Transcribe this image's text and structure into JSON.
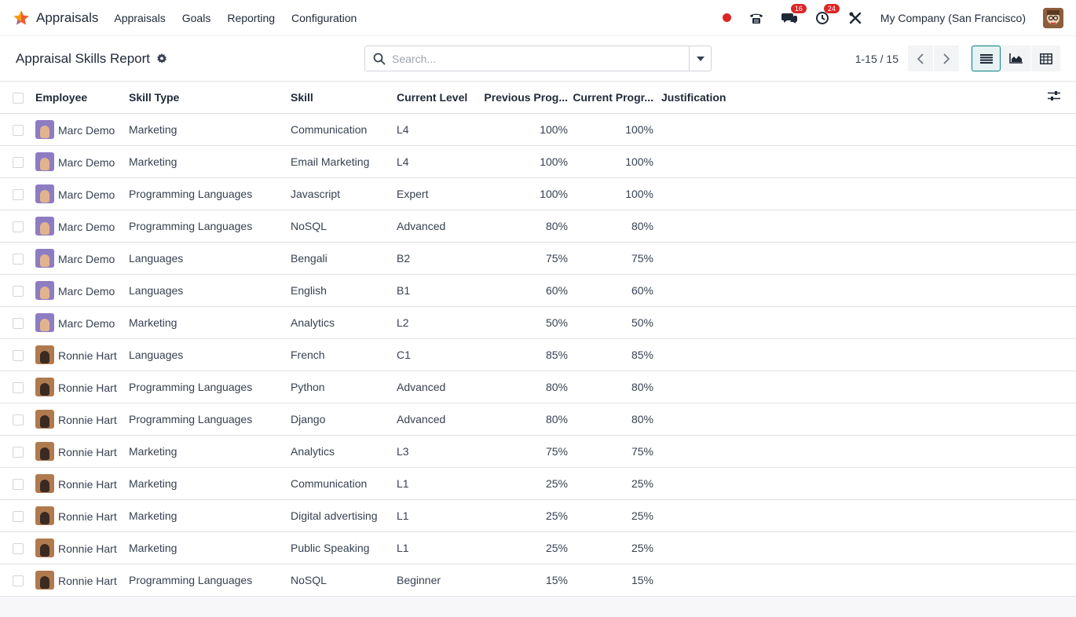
{
  "navbar": {
    "app_name": "Appraisals",
    "menu": [
      "Appraisals",
      "Goals",
      "Reporting",
      "Configuration"
    ],
    "messages_count": "16",
    "activities_count": "24",
    "company": "My Company (San Francisco)"
  },
  "control": {
    "title": "Appraisal Skills Report",
    "search_placeholder": "Search...",
    "pager": "1-15 / 15"
  },
  "table": {
    "headers": {
      "employee": "Employee",
      "skill_type": "Skill Type",
      "skill": "Skill",
      "current_level": "Current Level",
      "previous_progress": "Previous Prog...",
      "current_progress": "Current Progr...",
      "justification": "Justification"
    },
    "rows": [
      {
        "employee": "Marc Demo",
        "avatar": "marc",
        "skill_type": "Marketing",
        "skill": "Communication",
        "level": "L4",
        "prev": "100%",
        "cur": "100%"
      },
      {
        "employee": "Marc Demo",
        "avatar": "marc",
        "skill_type": "Marketing",
        "skill": "Email Marketing",
        "level": "L4",
        "prev": "100%",
        "cur": "100%"
      },
      {
        "employee": "Marc Demo",
        "avatar": "marc",
        "skill_type": "Programming Languages",
        "skill": "Javascript",
        "level": "Expert",
        "prev": "100%",
        "cur": "100%"
      },
      {
        "employee": "Marc Demo",
        "avatar": "marc",
        "skill_type": "Programming Languages",
        "skill": "NoSQL",
        "level": "Advanced",
        "prev": "80%",
        "cur": "80%"
      },
      {
        "employee": "Marc Demo",
        "avatar": "marc",
        "skill_type": "Languages",
        "skill": "Bengali",
        "level": "B2",
        "prev": "75%",
        "cur": "75%"
      },
      {
        "employee": "Marc Demo",
        "avatar": "marc",
        "skill_type": "Languages",
        "skill": "English",
        "level": "B1",
        "prev": "60%",
        "cur": "60%"
      },
      {
        "employee": "Marc Demo",
        "avatar": "marc",
        "skill_type": "Marketing",
        "skill": "Analytics",
        "level": "L2",
        "prev": "50%",
        "cur": "50%"
      },
      {
        "employee": "Ronnie Hart",
        "avatar": "ronnie",
        "skill_type": "Languages",
        "skill": "French",
        "level": "C1",
        "prev": "85%",
        "cur": "85%"
      },
      {
        "employee": "Ronnie Hart",
        "avatar": "ronnie",
        "skill_type": "Programming Languages",
        "skill": "Python",
        "level": "Advanced",
        "prev": "80%",
        "cur": "80%"
      },
      {
        "employee": "Ronnie Hart",
        "avatar": "ronnie",
        "skill_type": "Programming Languages",
        "skill": "Django",
        "level": "Advanced",
        "prev": "80%",
        "cur": "80%"
      },
      {
        "employee": "Ronnie Hart",
        "avatar": "ronnie",
        "skill_type": "Marketing",
        "skill": "Analytics",
        "level": "L3",
        "prev": "75%",
        "cur": "75%"
      },
      {
        "employee": "Ronnie Hart",
        "avatar": "ronnie",
        "skill_type": "Marketing",
        "skill": "Communication",
        "level": "L1",
        "prev": "25%",
        "cur": "25%"
      },
      {
        "employee": "Ronnie Hart",
        "avatar": "ronnie",
        "skill_type": "Marketing",
        "skill": "Digital advertising",
        "level": "L1",
        "prev": "25%",
        "cur": "25%"
      },
      {
        "employee": "Ronnie Hart",
        "avatar": "ronnie",
        "skill_type": "Marketing",
        "skill": "Public Speaking",
        "level": "L1",
        "prev": "25%",
        "cur": "25%"
      },
      {
        "employee": "Ronnie Hart",
        "avatar": "ronnie",
        "skill_type": "Programming Languages",
        "skill": "NoSQL",
        "level": "Beginner",
        "prev": "15%",
        "cur": "15%"
      }
    ]
  }
}
